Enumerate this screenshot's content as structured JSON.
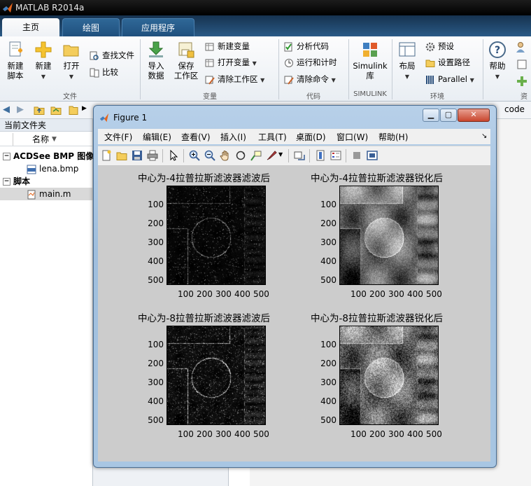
{
  "app": {
    "title": "MATLAB R2014a"
  },
  "tabs": [
    {
      "label": "主页",
      "active": true
    },
    {
      "label": "绘图",
      "active": false
    },
    {
      "label": "应用程序",
      "active": false
    }
  ],
  "ribbon": {
    "new_script": "新建\n脚本",
    "new": "新建",
    "open": "打开",
    "find_files": "查找文件",
    "compare": "比较",
    "file_group": "文件",
    "import_data": "导入\n数据",
    "save_workspace": "保存\n工作区",
    "new_variable": "新建变量",
    "open_variable": "打开变量",
    "clear_workspace": "清除工作区",
    "variable_group": "变量",
    "analyze_code": "分析代码",
    "run_and_time": "运行和计时",
    "clear_commands": "清除命令",
    "code_group": "代码",
    "simulink": "Simulink\n库",
    "simulink_group": "SIMULINK",
    "layout": "布局",
    "preferences": "预设",
    "set_path": "设置路径",
    "parallel": "Parallel",
    "env_group": "环境",
    "help": "帮助",
    "resources_group_partial": "资"
  },
  "address": {
    "folder_tail": "code"
  },
  "current_folder": {
    "header": "当前文件夹",
    "column_name": "名称",
    "groups": [
      {
        "label": "ACDSee BMP 图像",
        "items": [
          "lena.bmp"
        ]
      },
      {
        "label": "脚本",
        "items": [
          "main.m"
        ]
      }
    ]
  },
  "figure": {
    "title": "Figure 1",
    "menus": [
      "文件(F)",
      "编辑(E)",
      "查看(V)",
      "插入(I)",
      "工具(T)",
      "桌面(D)",
      "窗口(W)",
      "帮助(H)"
    ],
    "subplots": [
      {
        "title": "中心为-4拉普拉斯滤波器滤波后"
      },
      {
        "title": "中心为-4拉普拉斯滤波器锐化后"
      },
      {
        "title": "中心为-8拉普拉斯滤波器滤波后"
      },
      {
        "title": "中心为-8拉普拉斯滤波器锐化后"
      }
    ],
    "yticks": [
      "100",
      "200",
      "300",
      "400",
      "500"
    ],
    "xticks": [
      "100",
      "200",
      "300",
      "400",
      "500"
    ]
  },
  "colors": {
    "accent": "#2a5a86",
    "figure_bg": "#cccccc"
  }
}
